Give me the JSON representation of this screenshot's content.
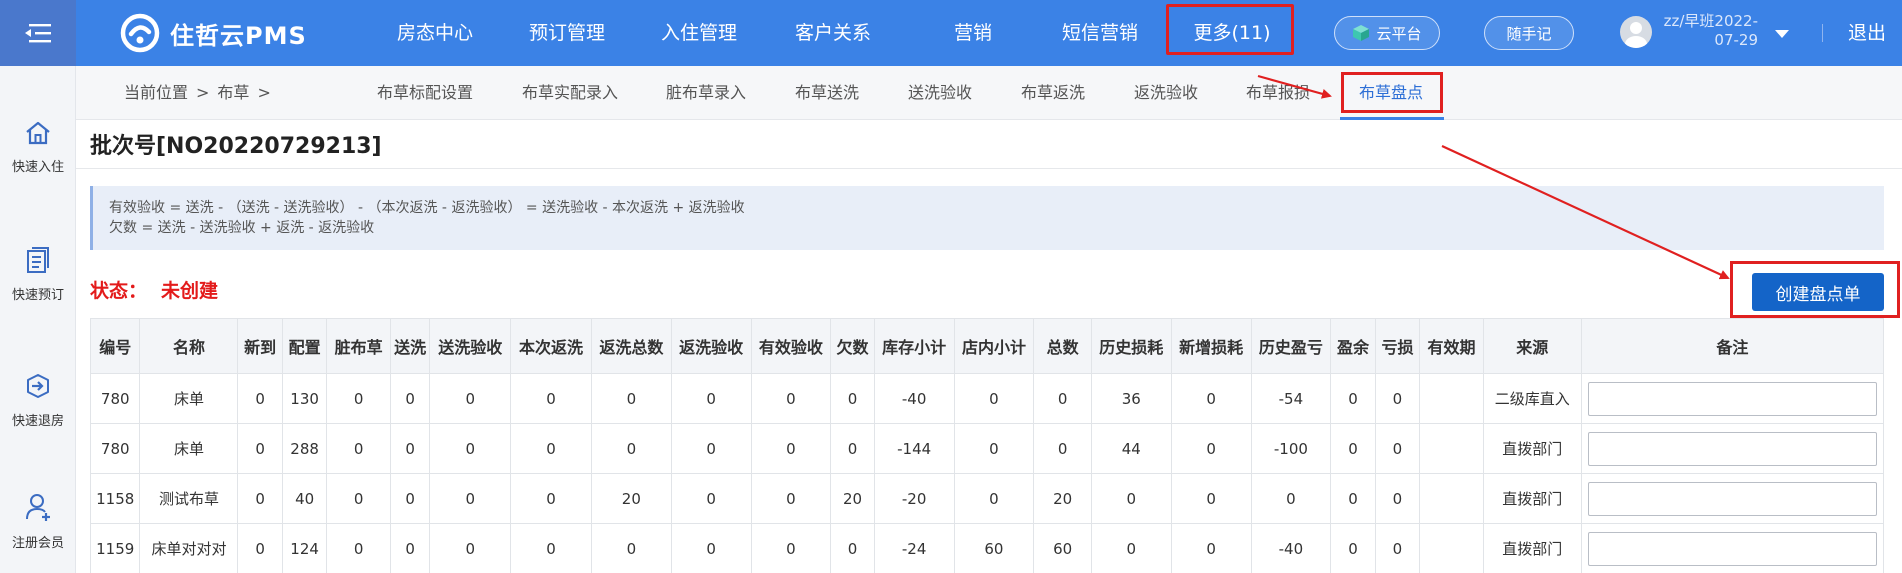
{
  "header": {
    "brand": "住哲云PMS",
    "nav": [
      {
        "label": "房态中心"
      },
      {
        "label": "预订管理"
      },
      {
        "label": "入住管理"
      },
      {
        "label": "客户关系"
      },
      {
        "label": "营销"
      },
      {
        "label": "短信营销"
      },
      {
        "label": "更多(11)"
      }
    ],
    "cloud_label": "云平台",
    "note_label": "随手记",
    "user_line1": "zz/早班2022-",
    "user_line2": "07-29",
    "logout_label": "退出"
  },
  "sidebar": {
    "items": [
      {
        "label": "快速入住",
        "icon": "house-icon"
      },
      {
        "label": "快速预订",
        "icon": "document-icon"
      },
      {
        "label": "快速退房",
        "icon": "checkout-icon"
      },
      {
        "label": "注册会员",
        "icon": "user-add-icon"
      }
    ]
  },
  "breadcrumb": {
    "prefix": "当前位置",
    "sep": ">",
    "section": "布草",
    "sep2": ">"
  },
  "subtabs": [
    {
      "label": "布草标配设置"
    },
    {
      "label": "布草实配录入"
    },
    {
      "label": "脏布草录入"
    },
    {
      "label": "布草送洗"
    },
    {
      "label": "送洗验收"
    },
    {
      "label": "布草返洗"
    },
    {
      "label": "返洗验收"
    },
    {
      "label": "布草报损"
    },
    {
      "label": "布草盘点",
      "active": true
    }
  ],
  "main": {
    "batch_title": "批次号[NO20220729213]",
    "formula_line1": "有效验收 = 送洗 - （送洗 - 送洗验收） - （本次返洗 - 返洗验收） = 送洗验收 - 本次返洗 + 返洗验收",
    "formula_line2": "欠数 = 送洗 - 送洗验收 + 返洗 - 返洗验收",
    "status_label": "状态：",
    "status_value": "未创建",
    "create_button": "创建盘点单"
  },
  "table": {
    "columns": [
      "编号",
      "名称",
      "新到",
      "配置",
      "脏布草",
      "送洗",
      "送洗验收",
      "本次返洗",
      "返洗总数",
      "返洗验收",
      "有效验收",
      "欠数",
      "库存小计",
      "店内小计",
      "总数",
      "历史损耗",
      "新增损耗",
      "历史盈亏",
      "盈余",
      "亏损",
      "有效期",
      "来源",
      "备注"
    ],
    "rows": [
      {
        "cells": [
          "780",
          "床单",
          "0",
          "130",
          "0",
          "0",
          "0",
          "0",
          "0",
          "0",
          "0",
          "0",
          "-40",
          "0",
          "0",
          "36",
          "0",
          "-54",
          "0",
          "0",
          "",
          "二级库直入"
        ],
        "note": ""
      },
      {
        "cells": [
          "780",
          "床单",
          "0",
          "288",
          "0",
          "0",
          "0",
          "0",
          "0",
          "0",
          "0",
          "0",
          "-144",
          "0",
          "0",
          "44",
          "0",
          "-100",
          "0",
          "0",
          "",
          "直拨部门"
        ],
        "note": ""
      },
      {
        "cells": [
          "1158",
          "测试布草",
          "0",
          "40",
          "0",
          "0",
          "0",
          "0",
          "20",
          "0",
          "0",
          "20",
          "-20",
          "0",
          "20",
          "0",
          "0",
          "0",
          "0",
          "0",
          "",
          "直拨部门"
        ],
        "note": ""
      },
      {
        "cells": [
          "1159",
          "床单对对对",
          "0",
          "124",
          "0",
          "0",
          "0",
          "0",
          "0",
          "0",
          "0",
          "0",
          "-24",
          "60",
          "60",
          "0",
          "0",
          "-40",
          "0",
          "0",
          "",
          "直拨部门"
        ],
        "note": ""
      }
    ]
  },
  "colors": {
    "topbar": "#3b82e6",
    "accent": "#1464c8",
    "highlight": "#e02020",
    "status": "#e31b1b"
  }
}
